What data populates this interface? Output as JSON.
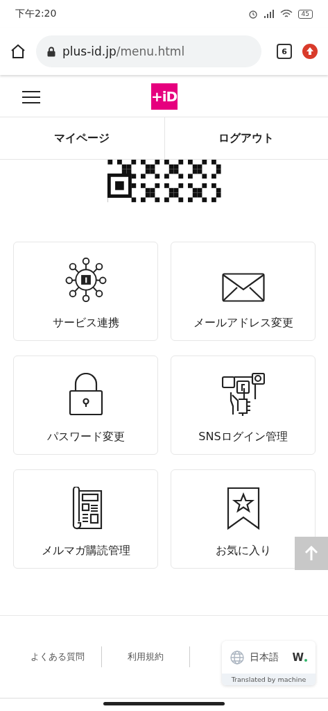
{
  "status_bar": {
    "time": "下午2:20",
    "battery": "45"
  },
  "browser": {
    "url_host": "plus-id.jp",
    "url_path": "/menu.html",
    "tab_count": "6"
  },
  "site_header": {
    "logo": "+iD"
  },
  "nav": [
    {
      "label": "マイページ"
    },
    {
      "label": "ログアウト"
    }
  ],
  "menu_cards": [
    {
      "kind": "services",
      "label": "サービス連携"
    },
    {
      "kind": "mail",
      "label": "メールアドレス変更"
    },
    {
      "kind": "password",
      "label": "パスワード変更"
    },
    {
      "kind": "sns",
      "label": "SNSログイン管理"
    },
    {
      "kind": "newsletter",
      "label": "メルマガ購読管理"
    },
    {
      "kind": "favorite",
      "label": "お気に入り"
    }
  ],
  "footer_links": [
    "よくある質問",
    "利用規約"
  ],
  "translate_widget": {
    "language": "日本語",
    "logo": "W",
    "note": "Translated by machine"
  }
}
